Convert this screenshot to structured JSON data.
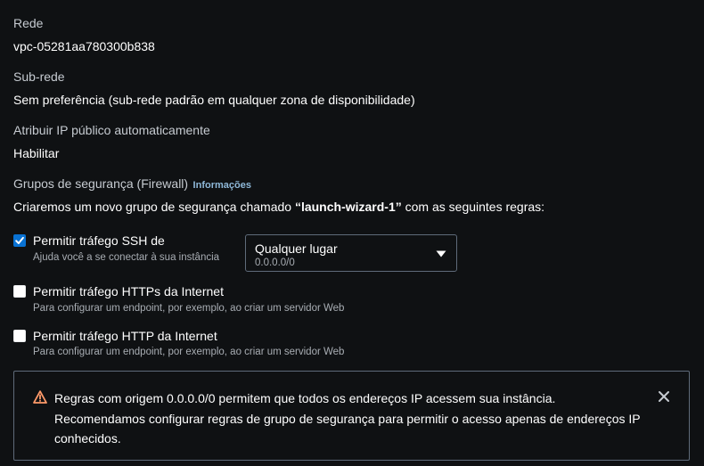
{
  "network": {
    "label": "Rede",
    "value": "vpc-05281aa780300b838"
  },
  "subnet": {
    "label": "Sub-rede",
    "value": "Sem preferência (sub-rede padrão em qualquer zona de disponibilidade)"
  },
  "public_ip": {
    "label": "Atribuir IP público automaticamente",
    "value": "Habilitar"
  },
  "security_groups": {
    "label": "Grupos de segurança (Firewall)",
    "info_link": "Informações",
    "description_before": "Criaremos um novo grupo de segurança chamado ",
    "group_name": "“launch-wizard-1”",
    "description_after": " com as seguintes regras:"
  },
  "rules": [
    {
      "title": "Permitir tráfego SSH de",
      "description": "Ajuda você a se conectar à sua instância",
      "checked": true
    },
    {
      "title": "Permitir tráfego HTTPs da Internet",
      "description": "Para configurar um endpoint, por exemplo, ao criar um servidor Web",
      "checked": false
    },
    {
      "title": "Permitir tráfego HTTP da Internet",
      "description": "Para configurar um endpoint, por exemplo, ao criar um servidor Web",
      "checked": false
    }
  ],
  "ssh_source_select": {
    "selected_label": "Qualquer lugar",
    "selected_value": "0.0.0.0/0"
  },
  "warning": {
    "line1": "Regras com origem 0.0.0.0/0 permitem que todos os endereços IP acessem sua instância.",
    "line2": "Recomendamos configurar regras de grupo de segurança para permitir o acesso apenas de endereços IP",
    "line3": "conhecidos."
  },
  "colors": {
    "background": "#0f1113",
    "accent": "#0972d3",
    "link": "#8fb9d9",
    "border": "#5f6b7a"
  }
}
